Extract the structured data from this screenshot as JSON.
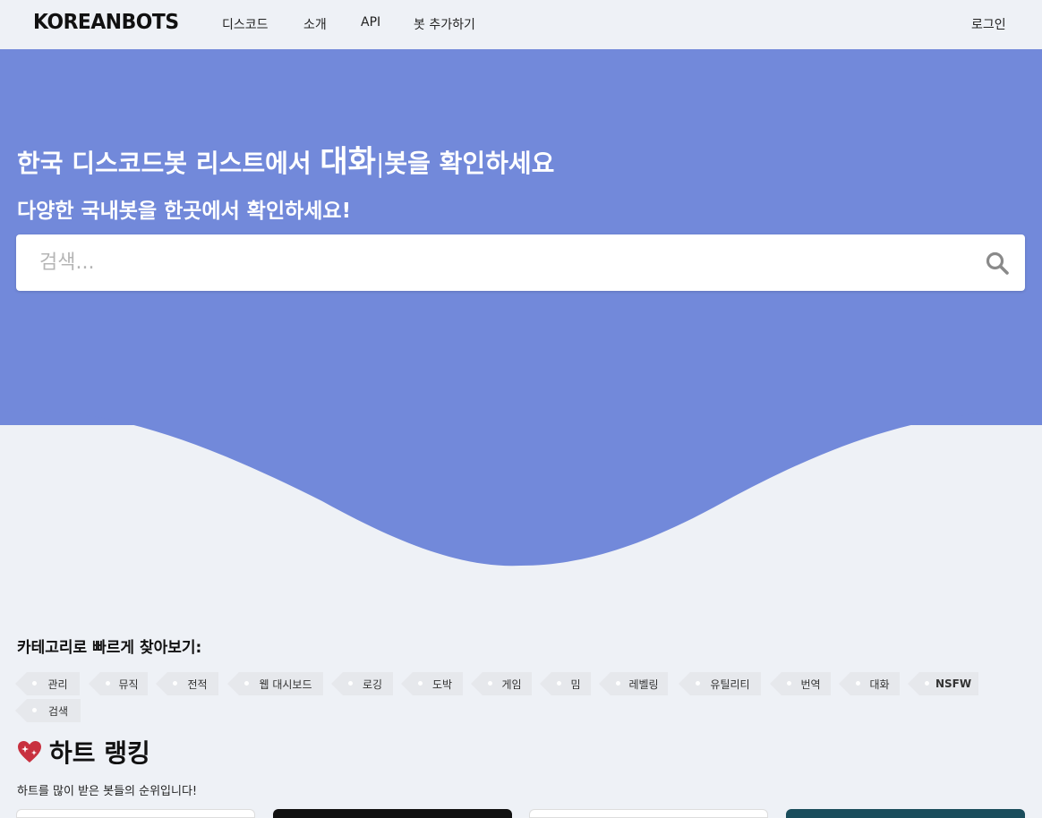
{
  "nav": {
    "logo": "KOREANBOTS",
    "links": [
      "디스코드",
      "소개",
      "API",
      "봇 추가하기"
    ],
    "login": "로그인"
  },
  "hero": {
    "title_prefix": "한국 디스코드봇 리스트에서 ",
    "title_accent": "대화",
    "title_cursor": "|",
    "title_suffix": "봇을 확인하세요",
    "subtitle": "다양한 국내봇을 한곳에서 확인하세요!",
    "search_placeholder": "검색...",
    "background_color": "#7289da"
  },
  "categories": {
    "heading": "카테고리로 빠르게 찾아보기:",
    "tags": [
      "관리",
      "뮤직",
      "전적",
      "웹 대시보드",
      "로깅",
      "도박",
      "게임",
      "밈",
      "레벨링",
      "유틸리티",
      "번역",
      "대화",
      "NSFW",
      "검색"
    ]
  },
  "ranking": {
    "title": "하트 랭킹",
    "subtitle": "하트를 많이 받은 봇들의 순위입니다!",
    "card_colors": [
      "#ffffff",
      "#111111",
      "#ffffff",
      "#1a4d5c"
    ]
  }
}
